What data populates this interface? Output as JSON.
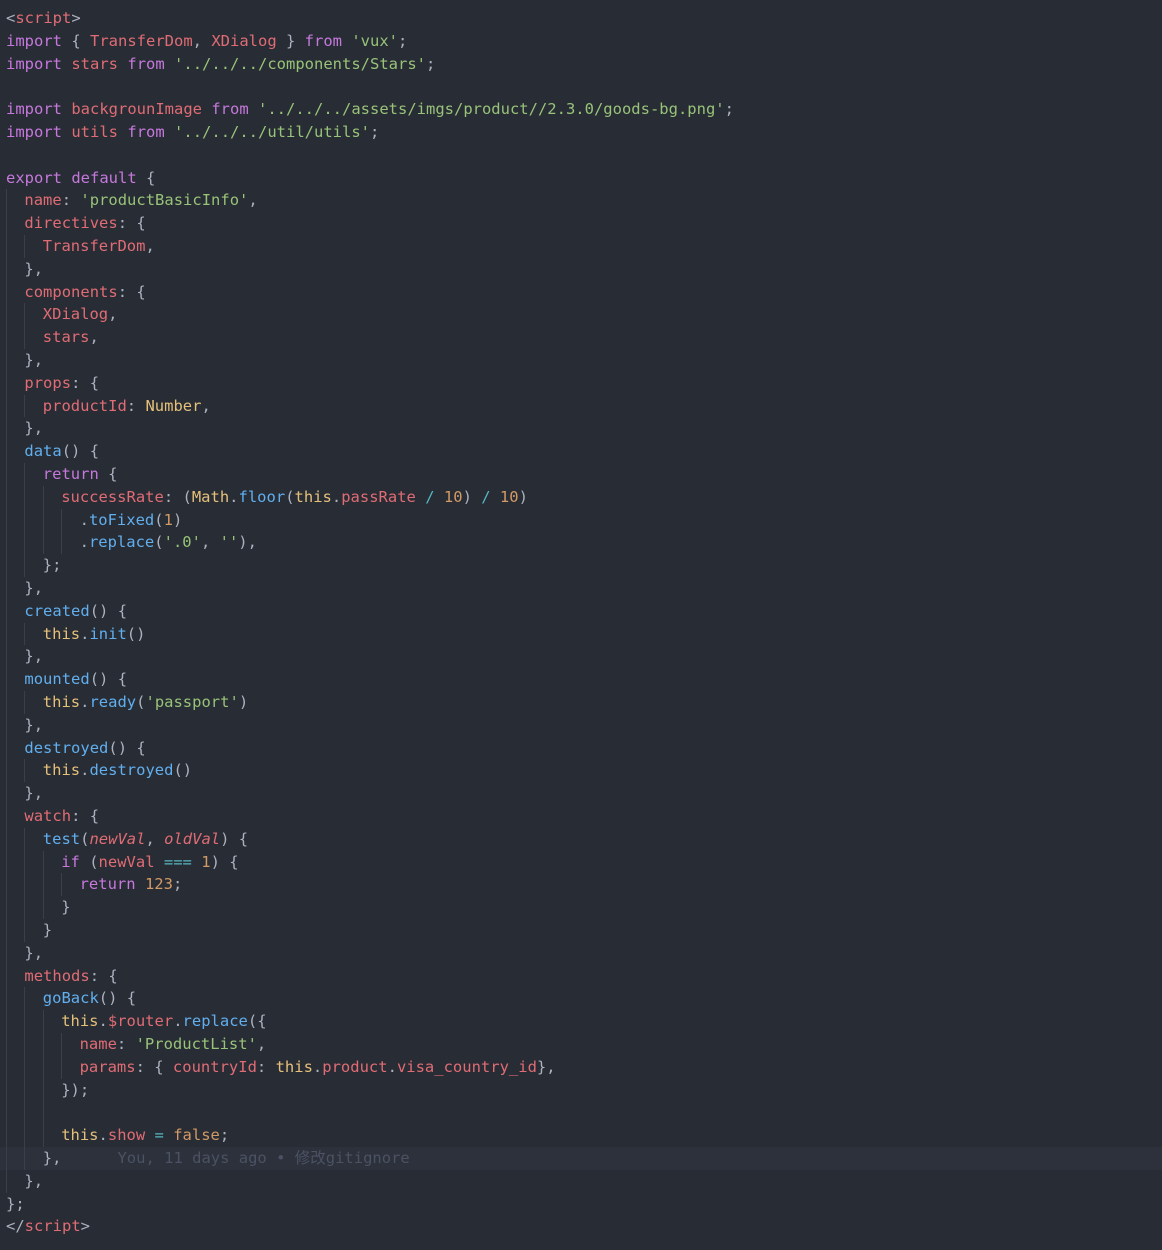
{
  "theme": {
    "background": "#282c34",
    "current_line": "#2c313c",
    "keyword": "#c678dd",
    "string": "#98c379",
    "property": "#e06c75",
    "function": "#61afef",
    "type": "#e5c07b",
    "number": "#d19a66",
    "operator": "#56b6c2",
    "plain": "#abb2bf",
    "blame": "#4b5263"
  },
  "editor": {
    "current_line_index": 50,
    "blame_annotation": "You, 11 days ago • 修改gitignore",
    "lines": [
      {
        "indent": 0,
        "tokens": [
          {
            "t": "<",
            "c": "plain"
          },
          {
            "t": "script",
            "c": "prop"
          },
          {
            "t": ">",
            "c": "plain"
          }
        ]
      },
      {
        "indent": 0,
        "tokens": [
          {
            "t": "import",
            "c": "kw"
          },
          {
            "t": " { ",
            "c": "plain"
          },
          {
            "t": "TransferDom",
            "c": "prop"
          },
          {
            "t": ", ",
            "c": "plain"
          },
          {
            "t": "XDialog",
            "c": "prop"
          },
          {
            "t": " } ",
            "c": "plain"
          },
          {
            "t": "from",
            "c": "kw"
          },
          {
            "t": " ",
            "c": "plain"
          },
          {
            "t": "'vux'",
            "c": "str"
          },
          {
            "t": ";",
            "c": "plain"
          }
        ]
      },
      {
        "indent": 0,
        "tokens": [
          {
            "t": "import",
            "c": "kw"
          },
          {
            "t": " ",
            "c": "plain"
          },
          {
            "t": "stars",
            "c": "prop"
          },
          {
            "t": " ",
            "c": "plain"
          },
          {
            "t": "from",
            "c": "kw"
          },
          {
            "t": " ",
            "c": "plain"
          },
          {
            "t": "'../../../components/Stars'",
            "c": "str"
          },
          {
            "t": ";",
            "c": "plain"
          }
        ]
      },
      {
        "indent": 0,
        "tokens": []
      },
      {
        "indent": 0,
        "tokens": [
          {
            "t": "import",
            "c": "kw"
          },
          {
            "t": " ",
            "c": "plain"
          },
          {
            "t": "backgrounImage",
            "c": "prop"
          },
          {
            "t": " ",
            "c": "plain"
          },
          {
            "t": "from",
            "c": "kw"
          },
          {
            "t": " ",
            "c": "plain"
          },
          {
            "t": "'../../../assets/imgs/product//2.3.0/goods-bg.png'",
            "c": "str"
          },
          {
            "t": ";",
            "c": "plain"
          }
        ]
      },
      {
        "indent": 0,
        "tokens": [
          {
            "t": "import",
            "c": "kw"
          },
          {
            "t": " ",
            "c": "plain"
          },
          {
            "t": "utils",
            "c": "prop"
          },
          {
            "t": " ",
            "c": "plain"
          },
          {
            "t": "from",
            "c": "kw"
          },
          {
            "t": " ",
            "c": "plain"
          },
          {
            "t": "'../../../util/utils'",
            "c": "str"
          },
          {
            "t": ";",
            "c": "plain"
          }
        ]
      },
      {
        "indent": 0,
        "tokens": []
      },
      {
        "indent": 0,
        "tokens": [
          {
            "t": "export",
            "c": "kw"
          },
          {
            "t": " ",
            "c": "plain"
          },
          {
            "t": "default",
            "c": "kw"
          },
          {
            "t": " {",
            "c": "plain"
          }
        ]
      },
      {
        "indent": 1,
        "tokens": [
          {
            "t": "name",
            "c": "prop"
          },
          {
            "t": ": ",
            "c": "plain"
          },
          {
            "t": "'productBasicInfo'",
            "c": "str"
          },
          {
            "t": ",",
            "c": "plain"
          }
        ]
      },
      {
        "indent": 1,
        "tokens": [
          {
            "t": "directives",
            "c": "prop"
          },
          {
            "t": ": {",
            "c": "plain"
          }
        ]
      },
      {
        "indent": 2,
        "tokens": [
          {
            "t": "TransferDom",
            "c": "prop"
          },
          {
            "t": ",",
            "c": "plain"
          }
        ]
      },
      {
        "indent": 1,
        "tokens": [
          {
            "t": "},",
            "c": "plain"
          }
        ]
      },
      {
        "indent": 1,
        "tokens": [
          {
            "t": "components",
            "c": "prop"
          },
          {
            "t": ": {",
            "c": "plain"
          }
        ]
      },
      {
        "indent": 2,
        "tokens": [
          {
            "t": "XDialog",
            "c": "prop"
          },
          {
            "t": ",",
            "c": "plain"
          }
        ]
      },
      {
        "indent": 2,
        "tokens": [
          {
            "t": "stars",
            "c": "prop"
          },
          {
            "t": ",",
            "c": "plain"
          }
        ]
      },
      {
        "indent": 1,
        "tokens": [
          {
            "t": "},",
            "c": "plain"
          }
        ]
      },
      {
        "indent": 1,
        "tokens": [
          {
            "t": "props",
            "c": "prop"
          },
          {
            "t": ": {",
            "c": "plain"
          }
        ]
      },
      {
        "indent": 2,
        "tokens": [
          {
            "t": "productId",
            "c": "prop"
          },
          {
            "t": ": ",
            "c": "plain"
          },
          {
            "t": "Number",
            "c": "type"
          },
          {
            "t": ",",
            "c": "plain"
          }
        ]
      },
      {
        "indent": 1,
        "tokens": [
          {
            "t": "},",
            "c": "plain"
          }
        ]
      },
      {
        "indent": 1,
        "tokens": [
          {
            "t": "data",
            "c": "fn"
          },
          {
            "t": "() {",
            "c": "plain"
          }
        ]
      },
      {
        "indent": 2,
        "tokens": [
          {
            "t": "return",
            "c": "kw"
          },
          {
            "t": " {",
            "c": "plain"
          }
        ]
      },
      {
        "indent": 3,
        "tokens": [
          {
            "t": "successRate",
            "c": "prop"
          },
          {
            "t": ": (",
            "c": "plain"
          },
          {
            "t": "Math",
            "c": "type"
          },
          {
            "t": ".",
            "c": "plain"
          },
          {
            "t": "floor",
            "c": "fn"
          },
          {
            "t": "(",
            "c": "plain"
          },
          {
            "t": "this",
            "c": "type"
          },
          {
            "t": ".",
            "c": "plain"
          },
          {
            "t": "passRate",
            "c": "prop"
          },
          {
            "t": " ",
            "c": "plain"
          },
          {
            "t": "/",
            "c": "op"
          },
          {
            "t": " ",
            "c": "plain"
          },
          {
            "t": "10",
            "c": "num"
          },
          {
            "t": ") ",
            "c": "plain"
          },
          {
            "t": "/",
            "c": "op"
          },
          {
            "t": " ",
            "c": "plain"
          },
          {
            "t": "10",
            "c": "num"
          },
          {
            "t": ")",
            "c": "plain"
          }
        ]
      },
      {
        "indent": 4,
        "tokens": [
          {
            "t": ".",
            "c": "plain"
          },
          {
            "t": "toFixed",
            "c": "fn"
          },
          {
            "t": "(",
            "c": "plain"
          },
          {
            "t": "1",
            "c": "num"
          },
          {
            "t": ")",
            "c": "plain"
          }
        ]
      },
      {
        "indent": 4,
        "tokens": [
          {
            "t": ".",
            "c": "plain"
          },
          {
            "t": "replace",
            "c": "fn"
          },
          {
            "t": "(",
            "c": "plain"
          },
          {
            "t": "'.0'",
            "c": "str"
          },
          {
            "t": ", ",
            "c": "plain"
          },
          {
            "t": "''",
            "c": "str"
          },
          {
            "t": "),",
            "c": "plain"
          }
        ]
      },
      {
        "indent": 2,
        "tokens": [
          {
            "t": "};",
            "c": "plain"
          }
        ]
      },
      {
        "indent": 1,
        "tokens": [
          {
            "t": "},",
            "c": "plain"
          }
        ]
      },
      {
        "indent": 1,
        "tokens": [
          {
            "t": "created",
            "c": "fn"
          },
          {
            "t": "() {",
            "c": "plain"
          }
        ]
      },
      {
        "indent": 2,
        "tokens": [
          {
            "t": "this",
            "c": "type"
          },
          {
            "t": ".",
            "c": "plain"
          },
          {
            "t": "init",
            "c": "fn"
          },
          {
            "t": "()",
            "c": "plain"
          }
        ]
      },
      {
        "indent": 1,
        "tokens": [
          {
            "t": "},",
            "c": "plain"
          }
        ]
      },
      {
        "indent": 1,
        "tokens": [
          {
            "t": "mounted",
            "c": "fn"
          },
          {
            "t": "() {",
            "c": "plain"
          }
        ]
      },
      {
        "indent": 2,
        "tokens": [
          {
            "t": "this",
            "c": "type"
          },
          {
            "t": ".",
            "c": "plain"
          },
          {
            "t": "ready",
            "c": "fn"
          },
          {
            "t": "(",
            "c": "plain"
          },
          {
            "t": "'passport'",
            "c": "str"
          },
          {
            "t": ")",
            "c": "plain"
          }
        ]
      },
      {
        "indent": 1,
        "tokens": [
          {
            "t": "},",
            "c": "plain"
          }
        ]
      },
      {
        "indent": 1,
        "tokens": [
          {
            "t": "destroyed",
            "c": "fn"
          },
          {
            "t": "() {",
            "c": "plain"
          }
        ]
      },
      {
        "indent": 2,
        "tokens": [
          {
            "t": "this",
            "c": "type"
          },
          {
            "t": ".",
            "c": "plain"
          },
          {
            "t": "destroyed",
            "c": "fn"
          },
          {
            "t": "()",
            "c": "plain"
          }
        ]
      },
      {
        "indent": 1,
        "tokens": [
          {
            "t": "},",
            "c": "plain"
          }
        ]
      },
      {
        "indent": 1,
        "tokens": [
          {
            "t": "watch",
            "c": "prop"
          },
          {
            "t": ": {",
            "c": "plain"
          }
        ]
      },
      {
        "indent": 2,
        "tokens": [
          {
            "t": "test",
            "c": "fn"
          },
          {
            "t": "(",
            "c": "plain"
          },
          {
            "t": "newVal",
            "c": "param"
          },
          {
            "t": ", ",
            "c": "plain"
          },
          {
            "t": "oldVal",
            "c": "param"
          },
          {
            "t": ") {",
            "c": "plain"
          }
        ]
      },
      {
        "indent": 3,
        "tokens": [
          {
            "t": "if",
            "c": "kw"
          },
          {
            "t": " (",
            "c": "plain"
          },
          {
            "t": "newVal",
            "c": "prop"
          },
          {
            "t": " ",
            "c": "plain"
          },
          {
            "t": "===",
            "c": "op"
          },
          {
            "t": " ",
            "c": "plain"
          },
          {
            "t": "1",
            "c": "num"
          },
          {
            "t": ") {",
            "c": "plain"
          }
        ]
      },
      {
        "indent": 4,
        "tokens": [
          {
            "t": "return",
            "c": "kw"
          },
          {
            "t": " ",
            "c": "plain"
          },
          {
            "t": "123",
            "c": "num"
          },
          {
            "t": ";",
            "c": "plain"
          }
        ]
      },
      {
        "indent": 3,
        "tokens": [
          {
            "t": "}",
            "c": "plain"
          }
        ]
      },
      {
        "indent": 2,
        "tokens": [
          {
            "t": "}",
            "c": "plain"
          }
        ]
      },
      {
        "indent": 1,
        "tokens": [
          {
            "t": "},",
            "c": "plain"
          }
        ]
      },
      {
        "indent": 1,
        "tokens": [
          {
            "t": "methods",
            "c": "prop"
          },
          {
            "t": ": {",
            "c": "plain"
          }
        ]
      },
      {
        "indent": 2,
        "tokens": [
          {
            "t": "goBack",
            "c": "fn"
          },
          {
            "t": "() {",
            "c": "plain"
          }
        ]
      },
      {
        "indent": 3,
        "tokens": [
          {
            "t": "this",
            "c": "type"
          },
          {
            "t": ".",
            "c": "plain"
          },
          {
            "t": "$router",
            "c": "prop"
          },
          {
            "t": ".",
            "c": "plain"
          },
          {
            "t": "replace",
            "c": "fn"
          },
          {
            "t": "({",
            "c": "plain"
          }
        ]
      },
      {
        "indent": 4,
        "tokens": [
          {
            "t": "name",
            "c": "prop"
          },
          {
            "t": ": ",
            "c": "plain"
          },
          {
            "t": "'ProductList'",
            "c": "str"
          },
          {
            "t": ",",
            "c": "plain"
          }
        ]
      },
      {
        "indent": 4,
        "tokens": [
          {
            "t": "params",
            "c": "prop"
          },
          {
            "t": ": { ",
            "c": "plain"
          },
          {
            "t": "countryId",
            "c": "prop"
          },
          {
            "t": ": ",
            "c": "plain"
          },
          {
            "t": "this",
            "c": "type"
          },
          {
            "t": ".",
            "c": "plain"
          },
          {
            "t": "product",
            "c": "prop"
          },
          {
            "t": ".",
            "c": "plain"
          },
          {
            "t": "visa_country_id",
            "c": "prop"
          },
          {
            "t": "},",
            "c": "plain"
          }
        ]
      },
      {
        "indent": 3,
        "tokens": [
          {
            "t": "});",
            "c": "plain"
          }
        ]
      },
      {
        "indent": 3,
        "tokens": []
      },
      {
        "indent": 3,
        "tokens": [
          {
            "t": "this",
            "c": "type"
          },
          {
            "t": ".",
            "c": "plain"
          },
          {
            "t": "show",
            "c": "prop"
          },
          {
            "t": " ",
            "c": "plain"
          },
          {
            "t": "=",
            "c": "op"
          },
          {
            "t": " ",
            "c": "plain"
          },
          {
            "t": "false",
            "c": "num"
          },
          {
            "t": ";",
            "c": "plain"
          }
        ]
      },
      {
        "indent": 2,
        "tokens": [
          {
            "t": "},",
            "c": "plain"
          }
        ]
      },
      {
        "indent": 1,
        "tokens": [
          {
            "t": "},",
            "c": "plain"
          }
        ]
      },
      {
        "indent": 0,
        "tokens": [
          {
            "t": "};",
            "c": "plain"
          }
        ]
      },
      {
        "indent": 0,
        "tokens": [
          {
            "t": "</",
            "c": "plain"
          },
          {
            "t": "script",
            "c": "prop"
          },
          {
            "t": ">",
            "c": "plain"
          }
        ]
      }
    ]
  }
}
